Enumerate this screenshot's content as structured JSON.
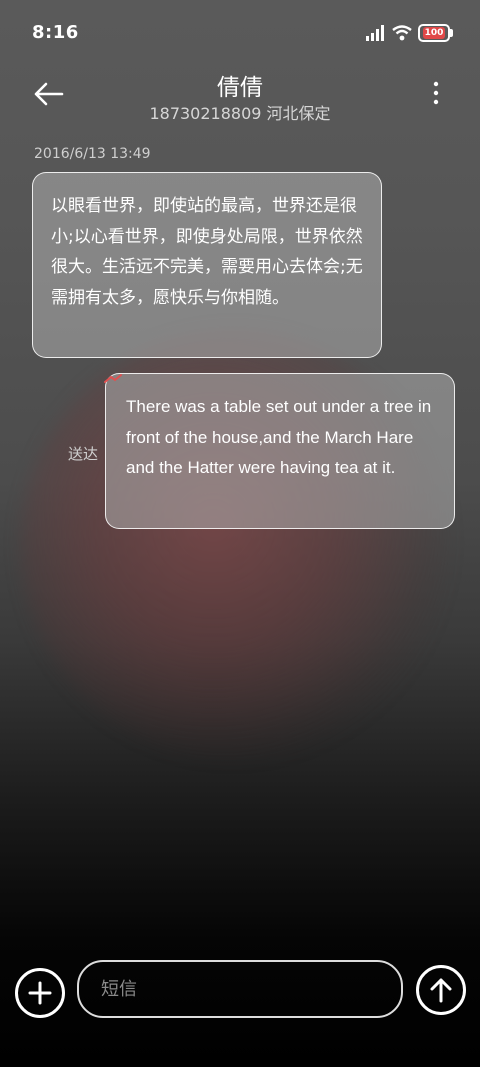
{
  "status_bar": {
    "time": "8:16",
    "battery": "100",
    "icons": [
      "signal-icon",
      "wifi-icon",
      "battery-icon"
    ]
  },
  "header": {
    "back_icon": "arrow-left-icon",
    "contact_name": "倩倩",
    "contact_info": "18730218809 河北保定",
    "more_icon": "more-vertical-icon"
  },
  "conversation": {
    "timestamp": "2016/6/13 13:49",
    "received": {
      "text": "以眼看世界，即使站的最高，世界还是很小;以心看世界，即使身处局限，世界依然很大。生活远不完美，需要用心去体会;无需拥有太多，愿快乐与你相随。"
    },
    "sent": {
      "status": "送达",
      "text": "There was a table set out under a tree in front of the house,and the March Hare and the Hatter were having tea at it."
    }
  },
  "composer": {
    "add_icon": "plus-circle-icon",
    "placeholder": "短信",
    "send_icon": "arrow-up-circle-icon"
  },
  "colors": {
    "battery_badge": "#e04848",
    "bubble_fill": "#afafaf",
    "sent_mark": "#e05050"
  }
}
